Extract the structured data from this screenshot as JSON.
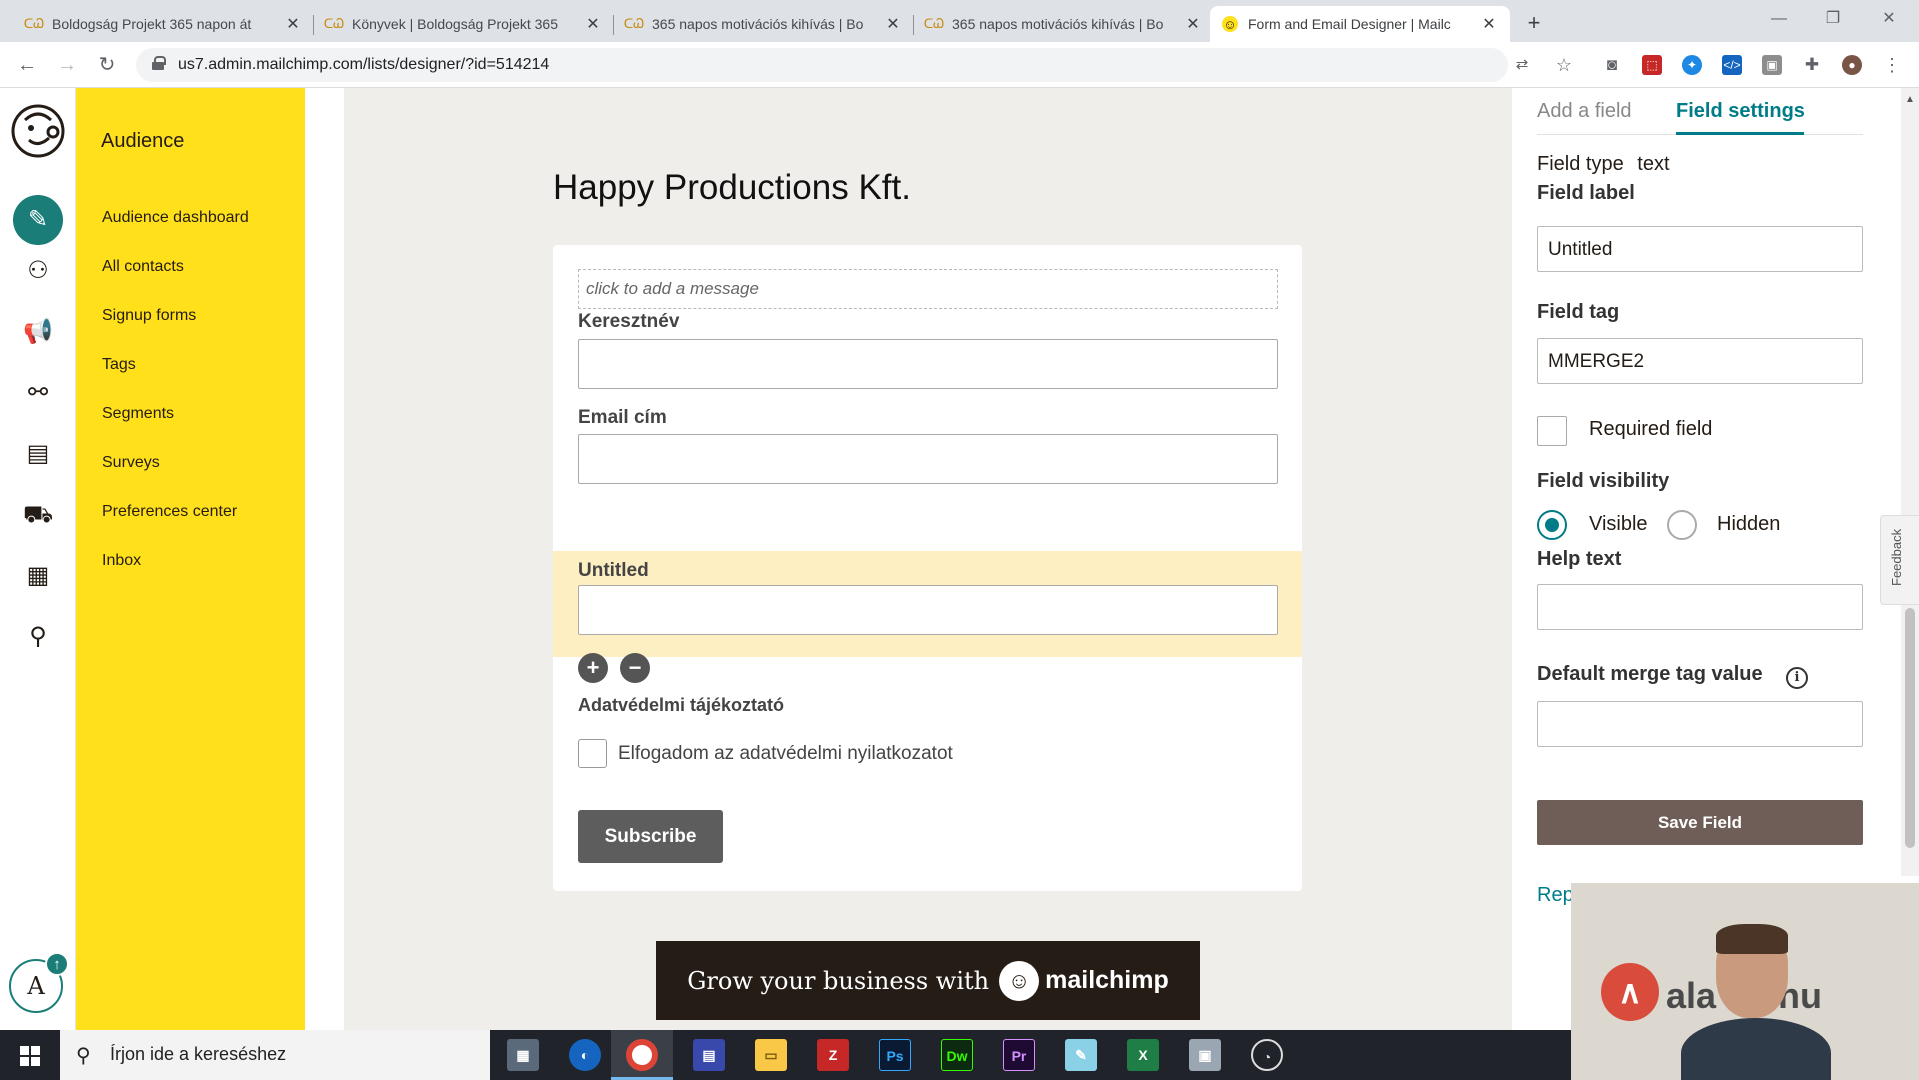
{
  "browser": {
    "tabs": [
      {
        "title": "Boldogság Projekt 365 napon át",
        "icon": "cw-favicon-icon"
      },
      {
        "title": "Könyvek | Boldogság Projekt 365",
        "icon": "cw-favicon-icon"
      },
      {
        "title": "365 napos motivációs kihívás | Bo",
        "icon": "cw-favicon-icon"
      },
      {
        "title": "365 napos motivációs kihívás | Bo",
        "icon": "cw-favicon-icon"
      },
      {
        "title": "Form and Email Designer | Mailc",
        "icon": "mailchimp-favicon-icon",
        "active": true
      }
    ],
    "url": "us7.admin.mailchimp.com/lists/designer/?id=514214"
  },
  "sidenav": {
    "heading": "Audience",
    "items": [
      "Audience dashboard",
      "All contacts",
      "Signup forms",
      "Tags",
      "Segments",
      "Surveys",
      "Preferences center",
      "Inbox"
    ],
    "accent": "#ffe01b"
  },
  "user": {
    "initial": "A"
  },
  "form": {
    "title": "Happy Productions Kft.",
    "message_placeholder": "click to add a message",
    "fields": [
      {
        "label": "Keresztnév"
      },
      {
        "label": "Email cím"
      },
      {
        "label": "Untitled",
        "selected": true
      }
    ],
    "gdpr_title": "Adatvédelmi tájékoztató",
    "gdpr_checkbox_label": "Elfogadom az adatvédelmi nyilatkozatot",
    "subscribe_label": "Subscribe",
    "banner_text": "Grow your business with",
    "banner_brand": "mailchimp"
  },
  "panel": {
    "tabs": {
      "add": "Add a field",
      "settings": "Field settings"
    },
    "field_type_label": "Field type",
    "field_type_value": "text",
    "field_label_label": "Field label",
    "field_label_value": "Untitled",
    "field_tag_label": "Field tag",
    "field_tag_value": "MMERGE2",
    "required_label": "Required field",
    "required_checked": false,
    "visibility_label": "Field visibility",
    "visible_label": "Visible",
    "hidden_label": "Hidden",
    "visibility_selected": "Visible",
    "help_text_label": "Help text",
    "help_text_value": "",
    "default_merge_label": "Default merge tag value",
    "default_merge_value": "",
    "save_label": "Save Field",
    "link_partial": "Rep",
    "accent": "#007c89"
  },
  "feedback_label": "Feedback",
  "webcam": {
    "site_text": "ala     ók.hu"
  },
  "taskbar": {
    "search_placeholder": "Írjon ide a kereséshez",
    "apps": [
      "calculator-icon",
      "outlook-icon",
      "chrome-icon",
      "save-app-icon",
      "file-explorer-icon",
      "filezilla-icon",
      "photoshop-icon",
      "dreamweaver-icon",
      "premiere-icon",
      "notepad-icon",
      "excel-icon",
      "network-app-icon",
      "clock-app-icon"
    ],
    "app_labels": {
      "photoshop": "Ps",
      "dreamweaver": "Dw",
      "premiere": "Pr",
      "excel": "X",
      "filezilla": "Z"
    }
  }
}
